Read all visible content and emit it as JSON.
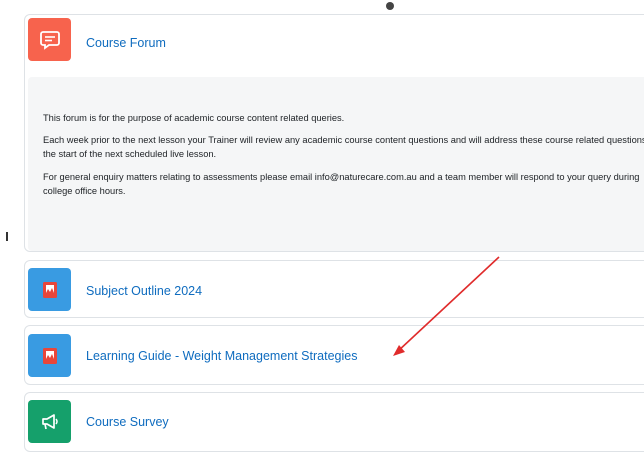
{
  "forum": {
    "title": "Course Forum",
    "icon": "forum-icon",
    "icon_color": "#f7634d",
    "description": [
      "This forum is for the purpose of academic course content related queries.",
      "Each week prior to the next lesson your Trainer will review any academic course content questions and will address these course related questions at the start of the next scheduled live lesson.",
      "For general enquiry matters relating to assessments please email info@naturecare.com.au and a team member will respond to your query during college office hours."
    ]
  },
  "activities": [
    {
      "title": "Subject Outline 2024",
      "icon": "pdf-icon",
      "icon_color": "#399be2"
    },
    {
      "title": "Learning Guide - Weight Management Strategies",
      "icon": "pdf-icon",
      "icon_color": "#399be2"
    },
    {
      "title": "Course Survey",
      "icon": "feedback-icon",
      "icon_color": "#15a06b"
    }
  ],
  "annotation": {
    "type": "arrow",
    "color": "#e02b2b"
  }
}
